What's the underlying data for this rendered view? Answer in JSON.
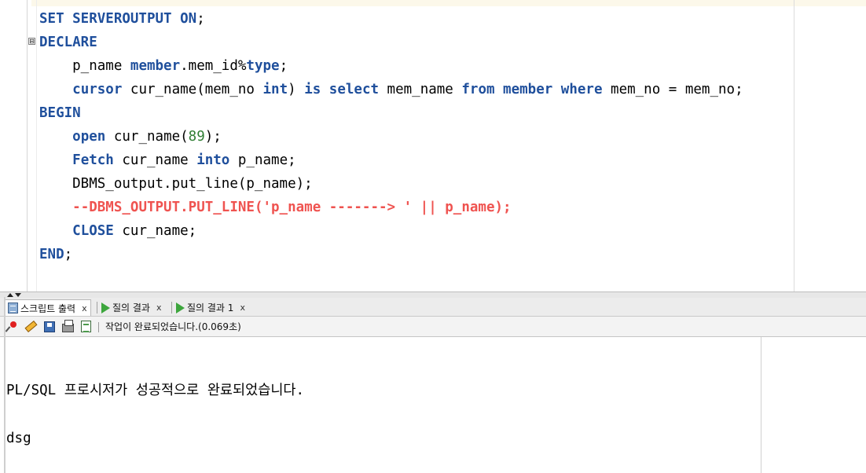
{
  "editor": {
    "lines": [
      {
        "id": "l1",
        "segments": [
          {
            "t": "SET SERVEROUTPUT ON",
            "c": "kw"
          },
          {
            "t": ";",
            "c": ""
          }
        ]
      },
      {
        "id": "l2",
        "segments": [
          {
            "t": "DECLARE",
            "c": "kw"
          }
        ]
      },
      {
        "id": "l3",
        "segments": [
          {
            "t": "    p_name ",
            "c": ""
          },
          {
            "t": "member",
            "c": "kw"
          },
          {
            "t": ".mem_id%",
            "c": ""
          },
          {
            "t": "type",
            "c": "kw"
          },
          {
            "t": ";",
            "c": ""
          }
        ]
      },
      {
        "id": "l4",
        "segments": [
          {
            "t": "    ",
            "c": ""
          },
          {
            "t": "cursor",
            "c": "kw"
          },
          {
            "t": " cur_name(mem_no ",
            "c": ""
          },
          {
            "t": "int",
            "c": "kw"
          },
          {
            "t": ") ",
            "c": ""
          },
          {
            "t": "is select",
            "c": "kw"
          },
          {
            "t": " mem_name ",
            "c": ""
          },
          {
            "t": "from member where",
            "c": "kw"
          },
          {
            "t": " mem_no = mem_no;",
            "c": ""
          }
        ]
      },
      {
        "id": "l5",
        "segments": [
          {
            "t": "BEGIN",
            "c": "kw"
          }
        ]
      },
      {
        "id": "l6",
        "segments": [
          {
            "t": "    ",
            "c": ""
          },
          {
            "t": "open",
            "c": "kw"
          },
          {
            "t": " cur_name(",
            "c": ""
          },
          {
            "t": "89",
            "c": "num"
          },
          {
            "t": ");",
            "c": ""
          }
        ]
      },
      {
        "id": "l7",
        "segments": [
          {
            "t": "    ",
            "c": ""
          },
          {
            "t": "Fetch",
            "c": "kw"
          },
          {
            "t": " cur_name ",
            "c": ""
          },
          {
            "t": "into",
            "c": "kw"
          },
          {
            "t": " p_name;",
            "c": ""
          }
        ]
      },
      {
        "id": "l8",
        "segments": [
          {
            "t": "    DBMS_output.put_line(p_name);",
            "c": ""
          }
        ]
      },
      {
        "id": "l9",
        "segments": [
          {
            "t": "    ",
            "c": ""
          },
          {
            "t": "--DBMS_OUTPUT.PUT_LINE('p_name -------> ' || p_name);",
            "c": "cmt"
          }
        ]
      },
      {
        "id": "l10",
        "segments": [
          {
            "t": "    ",
            "c": ""
          },
          {
            "t": "CLOSE",
            "c": "kw"
          },
          {
            "t": " cur_name;",
            "c": ""
          }
        ]
      },
      {
        "id": "l11",
        "segments": [
          {
            "t": "END",
            "c": "kw"
          },
          {
            "t": ";",
            "c": ""
          }
        ]
      }
    ],
    "fold_symbol": "⊟"
  },
  "tabs": [
    {
      "label": "스크립트 출력",
      "close": "x",
      "icon": "script-output-icon",
      "active": true
    },
    {
      "label": "질의 결과",
      "close": "x",
      "icon": "run-query-icon",
      "active": false
    },
    {
      "label": "질의 결과 1",
      "close": "x",
      "icon": "run-query-icon",
      "active": false
    }
  ],
  "toolbar": {
    "status": "작업이 완료되었습니다.(0.069초)",
    "icons": [
      "pin-icon",
      "eraser-icon",
      "save-icon",
      "print-icon",
      "output-icon"
    ]
  },
  "output": {
    "lines": [
      "PL/SQL 프로시저가 성공적으로 완료되었습니다.",
      "dsg"
    ]
  },
  "colors": {
    "keyword": "#1f4f9c",
    "number": "#2e7d32",
    "comment": "#ef5350",
    "run_icon": "#3da63d"
  }
}
